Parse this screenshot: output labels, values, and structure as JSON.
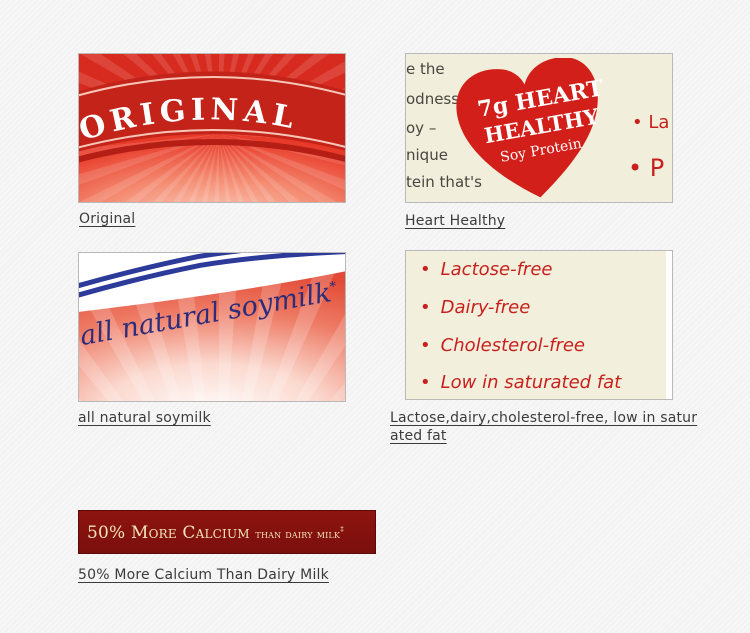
{
  "tiles": {
    "original": {
      "image_text": "ORIGINAL",
      "caption": "Original"
    },
    "heart_healthy": {
      "image_lines": [
        "e the",
        "odness",
        "oy –",
        "nique",
        "tein that's"
      ],
      "heart_lines": [
        "7g HEART",
        "HEALTHY",
        "Soy Protein"
      ],
      "bullet_fragments": [
        "• La",
        "• P"
      ],
      "caption": "Heart Healthy"
    },
    "soymilk": {
      "image_text": "all natural soymilk",
      "image_mark": "*",
      "caption": "all natural soymilk"
    },
    "free_list": {
      "items": [
        "Lactose-free",
        "Dairy-free",
        "Cholesterol-free",
        "Low in saturated fat"
      ],
      "bullet": "•",
      "caption": "Lactose,dairy,cholesterol-free, low in saturated fat"
    },
    "calcium": {
      "banner_main": "50% More Calcium",
      "banner_small": "than dairy milk",
      "banner_mark": "‡",
      "caption": "50% More Calcium Than Dairy Milk"
    }
  },
  "colors": {
    "background": "#f3f3f3",
    "caption_text": "#3b3b3b",
    "brand_red": "#d82b1f",
    "heart_red": "#d21f1a",
    "list_red": "#c8211d",
    "banner_red": "#7a0f0c",
    "banner_text": "#f2e3b8",
    "soy_blue": "#2c2d7a"
  }
}
